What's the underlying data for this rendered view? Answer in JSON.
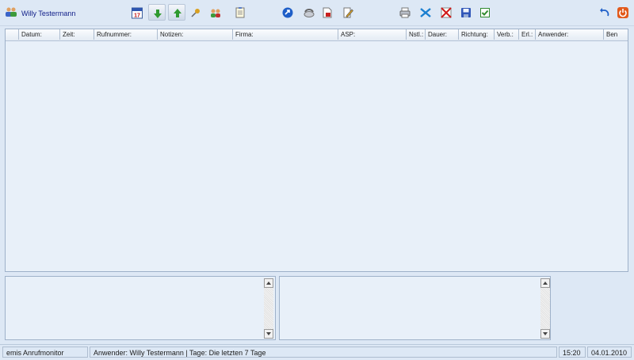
{
  "header": {
    "user_name": "Willy Testermann"
  },
  "toolbar": {
    "buttons": [
      {
        "icon": "calendar-icon"
      },
      {
        "icon": "arrow-down-icon"
      },
      {
        "icon": "arrow-up-icon"
      },
      {
        "icon": "pin-icon"
      },
      {
        "icon": "users-icon"
      },
      {
        "icon": "notepad-icon"
      },
      {
        "icon": "navigate-icon"
      },
      {
        "icon": "phone-icon"
      },
      {
        "icon": "document-icon"
      },
      {
        "icon": "edit-icon"
      },
      {
        "icon": "printer-icon"
      },
      {
        "icon": "excel-icon"
      },
      {
        "icon": "delete-icon"
      },
      {
        "icon": "save-icon"
      },
      {
        "icon": "checklist-icon"
      },
      {
        "icon": "undo-icon"
      },
      {
        "icon": "power-icon"
      }
    ],
    "calendar_day": "17"
  },
  "grid": {
    "columns": [
      "Datum:",
      "Zeit:",
      "Rufnummer:",
      "Notizen:",
      "Firma:",
      "ASP:",
      "Nstl.:",
      "Dauer:",
      "Richtung:",
      "Verb.:",
      "Erl.:",
      "Anwender:",
      "Ben"
    ],
    "rows": []
  },
  "status": {
    "app_name": "emis Anrufmonitor",
    "info": "Anwender: Willy Testermann | Tage: Die letzten 7 Tage",
    "time": "15:20",
    "date": "04.01.2010"
  },
  "colors": {
    "background": "#dde8f5",
    "panel": "#e8f0f9",
    "border": "#9eb1c9",
    "user_name_text": "#12208a"
  }
}
